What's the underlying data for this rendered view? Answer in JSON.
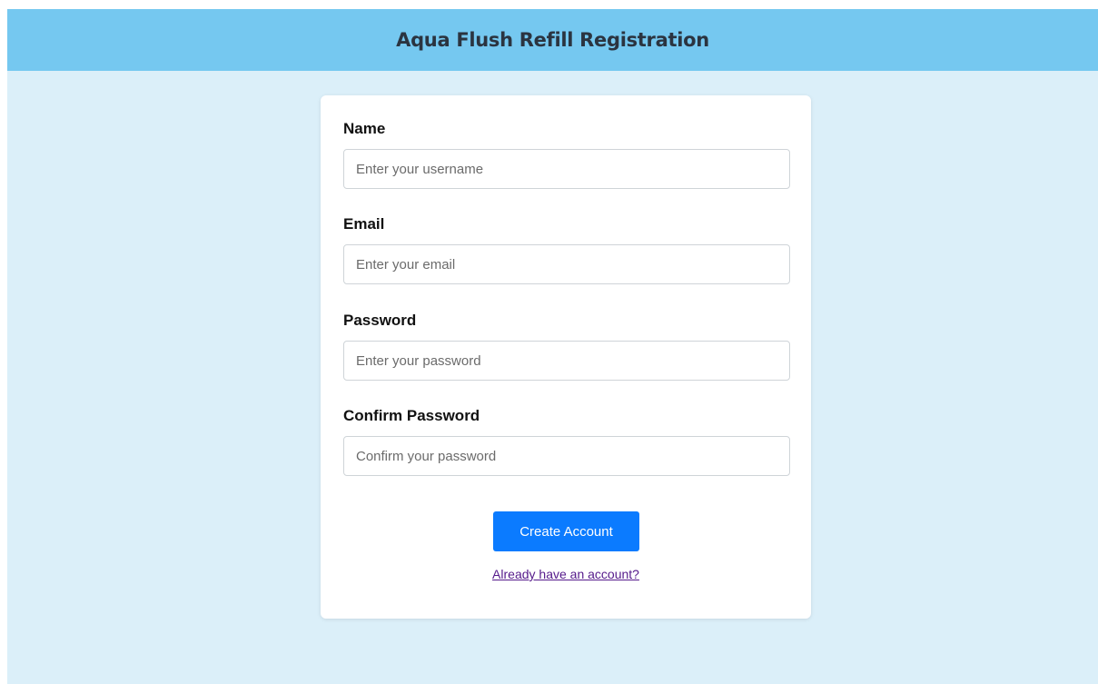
{
  "header": {
    "title": "Aqua Flush Refill Registration"
  },
  "form": {
    "fields": [
      {
        "label": "Name",
        "placeholder": "Enter your username",
        "value": ""
      },
      {
        "label": "Email",
        "placeholder": "Enter your email",
        "value": ""
      },
      {
        "label": "Password",
        "placeholder": "Enter your password",
        "value": ""
      },
      {
        "label": "Confirm Password",
        "placeholder": "Confirm your password",
        "value": ""
      }
    ],
    "submit_label": "Create Account",
    "login_link_text": "Already have an account?"
  },
  "colors": {
    "header_bg": "#75c8f0",
    "page_bg": "#dbeff9",
    "button_bg": "#0b7bff",
    "link": "#551a8b"
  }
}
